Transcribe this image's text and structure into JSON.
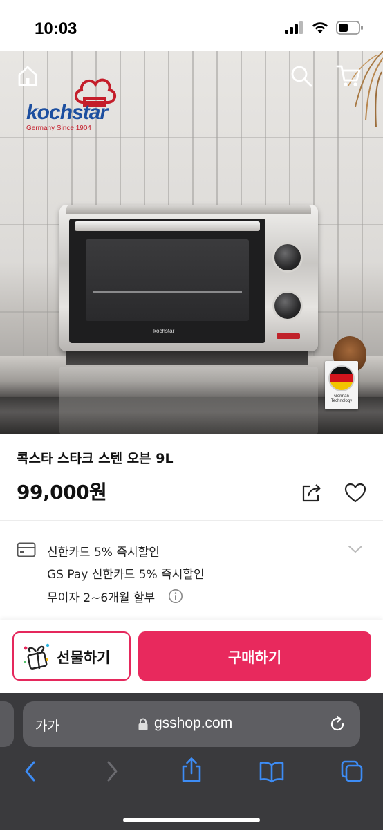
{
  "status_bar": {
    "time": "10:03"
  },
  "hero": {
    "brand_name": "kochstar",
    "brand_tagline": "Germany Since 1904",
    "oven_logo": "kochstar",
    "badge_text": "German Technology",
    "icons": [
      "home-icon",
      "search-icon",
      "cart-icon"
    ]
  },
  "product": {
    "title": "콕스타 스타크 스텐 오븐 9L",
    "price": "99,000원"
  },
  "benefits": {
    "card_line_1": "신한카드 5% 즉시할인",
    "card_line_2": "GS Pay 신한카드 5% 즉시할인",
    "installment": "무이자 2~6개월 할부"
  },
  "buy_bar": {
    "gift_label": "선물하기",
    "buy_label": "구매하기",
    "accent_color": "#e8295d"
  },
  "browser": {
    "aa_label": "가가",
    "url": "gsshop.com"
  }
}
